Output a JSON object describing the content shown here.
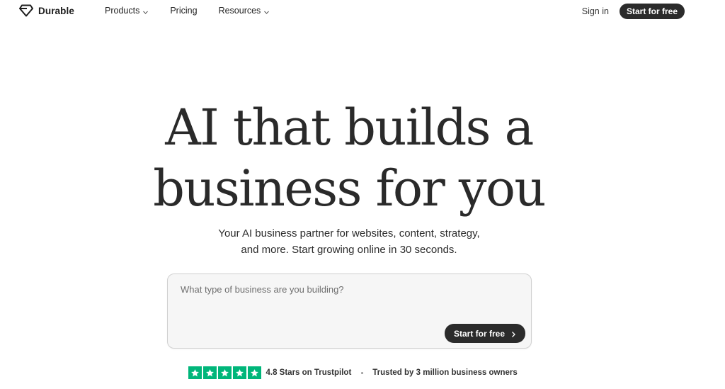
{
  "brand": {
    "name": "Durable",
    "icon": "diamond-logo-icon"
  },
  "nav": {
    "items": [
      {
        "label": "Products",
        "has_dropdown": true
      },
      {
        "label": "Pricing",
        "has_dropdown": false
      },
      {
        "label": "Resources",
        "has_dropdown": true
      }
    ],
    "signin_label": "Sign in",
    "cta_label": "Start for free"
  },
  "hero": {
    "title_line1": "AI that builds a",
    "title_line2": "business for you",
    "subtitle_line1": "Your AI business partner for websites, content, strategy,",
    "subtitle_line2": "and more. Start growing online in 30 seconds."
  },
  "prompt": {
    "placeholder": "What type of business are you building?",
    "value": "",
    "submit_label": "Start for free"
  },
  "proof": {
    "rating_text": "4.8 Stars on Trustpilot",
    "trusted_text": "Trusted by 3 million business owners",
    "star_count": 5
  },
  "colors": {
    "dark_button": "#2b2b2b",
    "trustpilot_green": "#00b67a",
    "text": "#1f1f1f",
    "input_bg": "#f6f6f6"
  }
}
